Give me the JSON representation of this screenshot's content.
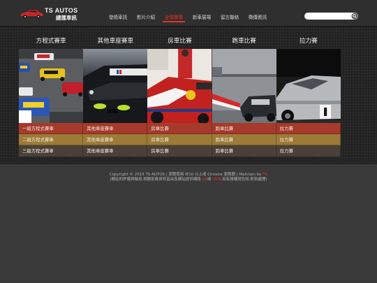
{
  "header": {
    "brand": "TS AUTOS",
    "brand_sub": "總匯車訊",
    "logo_icon": "red-sports-car-logo",
    "nav": [
      {
        "label": "發燒車訊",
        "active": false
      },
      {
        "label": "影片介紹",
        "active": false
      },
      {
        "label": "全球賽事",
        "active": true
      },
      {
        "label": "新車展場",
        "active": false
      },
      {
        "label": "留言聯絡",
        "active": false
      },
      {
        "label": "徵傳資訊",
        "active": false
      }
    ],
    "search": {
      "value": "",
      "placeholder": "",
      "icon": "search-icon"
    }
  },
  "colors": {
    "active_nav": "#e3322b",
    "row_1": "#a63a2b",
    "row_2": "#9c7a37",
    "row_3": "#4b4038",
    "background": "#3a3a3a"
  },
  "categories": [
    {
      "heading": "方程式賽車"
    },
    {
      "heading": "其他車座賽車"
    },
    {
      "heading": "房車比賽"
    },
    {
      "heading": "跑車比賽"
    },
    {
      "heading": "拉力賽"
    }
  ],
  "sub_rows": [
    [
      "一級方程式賽車",
      "其他車座賽車",
      "房車比賽",
      "跑車比賽",
      "拉力賽"
    ],
    [
      "二級方程式賽車",
      "其他車座賽車",
      "房車比賽",
      "跑車比賽",
      "拉力賽"
    ],
    [
      "三級方程式賽車",
      "其他車座賽車",
      "房車比賽",
      "跑車比賽",
      "拉力賽"
    ]
  ],
  "footer": {
    "copyright": "Copyright © 2015 TS AUTOS | 瀏覽使用 IE10 以上或 Chrome 瀏覽器 | Maintain by ",
    "maintainer": "TS",
    "notice_before": "(網站的許權與輸用,相關影像資訊皆由各網站提供網路 ",
    "source_1": "KA",
    "notice_middle": "或 ",
    "source_2": "UDN",
    "notice_after": ",如有侵權請告知,即刻處理)"
  }
}
